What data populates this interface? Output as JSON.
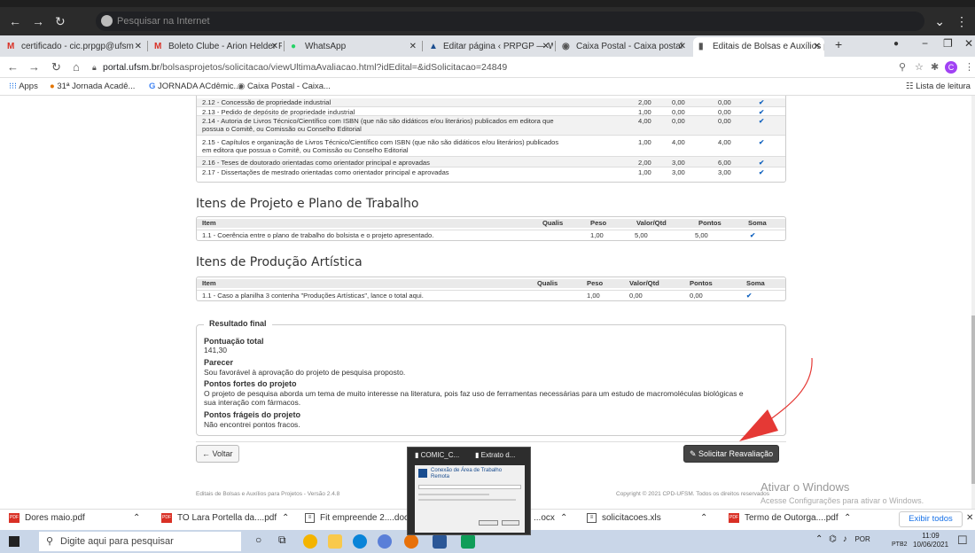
{
  "top_window": {
    "search_placeholder": "Pesquisar na Internet"
  },
  "tabs": [
    {
      "label": "certificado - cic.prpgp@ufsm",
      "icon": "gmail-icon"
    },
    {
      "label": "Boleto Clube - Arion Helder P",
      "icon": "gmail-icon"
    },
    {
      "label": "WhatsApp",
      "icon": "whatsapp-icon"
    },
    {
      "label": "Editar página ‹ PRPGP — Wor",
      "icon": "ufsm-icon"
    },
    {
      "label": "Caixa Postal - Caixa postal",
      "icon": "globe-icon"
    },
    {
      "label": "Editais de Bolsas e Auxílios pa",
      "icon": "document-icon"
    }
  ],
  "address": {
    "url_host": "portal.ufsm.br",
    "url_path": "/bolsasprojetos/solicitacao/viewUltimaAvaliacao.html?idEdital=&idSolicitacao=24849",
    "avatar": "C"
  },
  "bookmarks": {
    "items": [
      "Apps",
      "31ª Jornada Acadê...",
      "JORNADA ACdêmic...",
      "Caixa Postal - Caixa..."
    ],
    "reading_list": "Lista de leitura"
  },
  "productivity_rows": [
    {
      "item": "2.12 - Concessão de propriedade industrial",
      "peso": "2,00",
      "valor": "0,00",
      "pontos": "0,00"
    },
    {
      "item": "2.13 - Pedido de depósito de propriedade industrial",
      "peso": "1,00",
      "valor": "0,00",
      "pontos": "0,00"
    },
    {
      "item": "2.14 - Autoria de Livros Técnico/Científico com ISBN (que não são didáticos e/ou literários) publicados em editora que",
      "item2": "possua o Comitê, ou Comissão ou Conselho Editorial",
      "peso": "4,00",
      "valor": "0,00",
      "pontos": "0,00"
    },
    {
      "item": "2.15 - Capítulos e organização de Livros Técnico/Científico com ISBN (que não são didáticos e/ou literários) publicados",
      "item2": "em editora que possua o Comitê, ou Comissão ou Conselho Editorial",
      "peso": "1,00",
      "valor": "4,00",
      "pontos": "4,00"
    },
    {
      "item": "2.16 - Teses de doutorado orientadas como orientador principal e aprovadas",
      "peso": "2,00",
      "valor": "3,00",
      "pontos": "6,00"
    },
    {
      "item": "2.17 - Dissertações de mestrado orientadas como orientador principal e aprovadas",
      "peso": "1,00",
      "valor": "3,00",
      "pontos": "3,00"
    }
  ],
  "headers": {
    "item": "Item",
    "qualis": "Qualis",
    "peso": "Peso",
    "valor": "Valor/Qtd",
    "pontos": "Pontos",
    "soma": "Soma"
  },
  "check": "✔",
  "projeto": {
    "title": "Itens de Projeto e Plano de Trabalho",
    "row": {
      "item": "1.1 - Coerência entre o plano de trabalho do bolsista e o projeto apresentado.",
      "peso": "1,00",
      "valor": "5,00",
      "pontos": "5,00"
    }
  },
  "artistica": {
    "title": "Itens de Produção Artística",
    "row": {
      "item": "1.1 - Caso a planilha 3 contenha \"Produções Artísticas\", lance o total aqui.",
      "peso": "1,00",
      "valor": "0,00",
      "pontos": "0,00"
    }
  },
  "resultado": {
    "legend": "Resultado final",
    "pontuacao_label": "Pontuação total",
    "pontuacao": "141,30",
    "parecer_label": "Parecer",
    "parecer": "Sou favorável à aprovação do projeto de pesquisa proposto.",
    "fortes_label": "Pontos fortes do projeto",
    "fortes_1": "O projeto de pesquisa aborda um tema de muito interesse na literatura, pois faz uso de ferramentas necessárias para um estudo de macromoléculas biológicas e",
    "fortes_2": "sua interação com fármacos.",
    "frageis_label": "Pontos frágeis do projeto",
    "frageis": "Não encontrei pontos fracos."
  },
  "buttons": {
    "voltar": "← Voltar",
    "reavaliacao": "✎ Solicitar Reavaliação"
  },
  "footer": {
    "left": "Editais de Bolsas e Auxílios para Projetos - Versão 2.4.8",
    "right": "Copyright © 2021 CPD-UFSM. Todos os direitos reservados"
  },
  "popup": {
    "t1": "COMIC_C...",
    "t2": "Extrato d...",
    "thumb_title": "Conexão de Área de Trabalho Remota"
  },
  "downloads": [
    {
      "name": "Dores maio.pdf",
      "type": "pdf"
    },
    {
      "name": "TO Lara Portella da....pdf",
      "type": "pdf"
    },
    {
      "name": "Fit empreende 2....docx",
      "type": "doc"
    },
    {
      "name": "...ocx",
      "type": "doc"
    },
    {
      "name": "solicitacoes.xls",
      "type": "xls"
    },
    {
      "name": "Termo de Outorga....pdf",
      "type": "pdf"
    }
  ],
  "exibir_todos": "Exibir todos",
  "watermark": {
    "l1": "Ativar o Windows",
    "l2": "Acesse Configurações para ativar o Windows."
  },
  "taskbar": {
    "search": "Digite aqui para pesquisar",
    "lang": "POR",
    "lang2": "PTB2",
    "time": "11:09",
    "date": "10/06/2021"
  }
}
